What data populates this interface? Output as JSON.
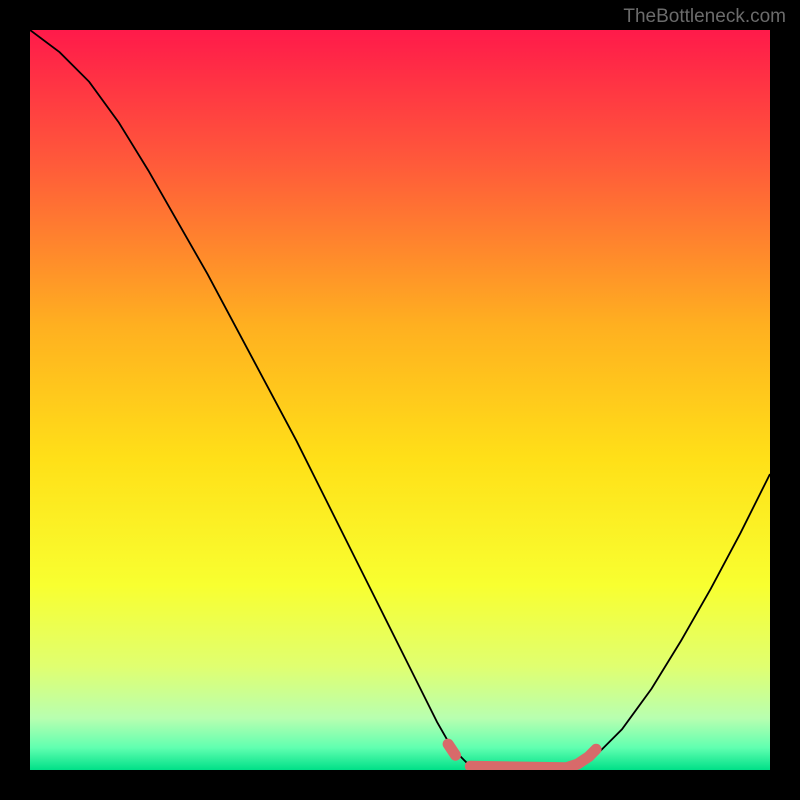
{
  "watermark": "TheBottleneck.com",
  "chart_data": {
    "type": "line",
    "title": "",
    "xlabel": "",
    "ylabel": "",
    "xlim": [
      0,
      100
    ],
    "ylim": [
      0,
      100
    ],
    "gradient_stops": [
      {
        "offset": 0,
        "color": "#ff1a4a"
      },
      {
        "offset": 18,
        "color": "#ff5a3a"
      },
      {
        "offset": 40,
        "color": "#ffb020"
      },
      {
        "offset": 58,
        "color": "#ffe018"
      },
      {
        "offset": 75,
        "color": "#f8ff30"
      },
      {
        "offset": 86,
        "color": "#e0ff70"
      },
      {
        "offset": 93,
        "color": "#b8ffb0"
      },
      {
        "offset": 97,
        "color": "#60ffb0"
      },
      {
        "offset": 100,
        "color": "#00e088"
      }
    ],
    "series": [
      {
        "name": "bottleneck-curve",
        "color": "#000000",
        "width": 1.8,
        "points": [
          {
            "x": 0,
            "y": 100
          },
          {
            "x": 4,
            "y": 97
          },
          {
            "x": 8,
            "y": 93
          },
          {
            "x": 12,
            "y": 87.5
          },
          {
            "x": 16,
            "y": 81
          },
          {
            "x": 20,
            "y": 74
          },
          {
            "x": 24,
            "y": 67
          },
          {
            "x": 28,
            "y": 59.5
          },
          {
            "x": 32,
            "y": 52
          },
          {
            "x": 36,
            "y": 44.5
          },
          {
            "x": 40,
            "y": 36.5
          },
          {
            "x": 44,
            "y": 28.5
          },
          {
            "x": 48,
            "y": 20.5
          },
          {
            "x": 52,
            "y": 12.5
          },
          {
            "x": 55,
            "y": 6.5
          },
          {
            "x": 57,
            "y": 3
          },
          {
            "x": 59,
            "y": 1
          },
          {
            "x": 61,
            "y": 0.3
          },
          {
            "x": 65,
            "y": 0
          },
          {
            "x": 70,
            "y": 0
          },
          {
            "x": 73,
            "y": 0.3
          },
          {
            "x": 75,
            "y": 1
          },
          {
            "x": 77,
            "y": 2.5
          },
          {
            "x": 80,
            "y": 5.5
          },
          {
            "x": 84,
            "y": 11
          },
          {
            "x": 88,
            "y": 17.5
          },
          {
            "x": 92,
            "y": 24.5
          },
          {
            "x": 96,
            "y": 32
          },
          {
            "x": 100,
            "y": 40
          }
        ]
      },
      {
        "name": "highlight-segment",
        "color": "#d86a6a",
        "width": 11,
        "cap": "round",
        "points": [
          {
            "x": 56.5,
            "y": 3.5
          },
          {
            "x": 57.5,
            "y": 2
          }
        ]
      },
      {
        "name": "highlight-flat",
        "color": "#d86a6a",
        "width": 11,
        "cap": "round",
        "points": [
          {
            "x": 59.5,
            "y": 0.5
          },
          {
            "x": 72.5,
            "y": 0.3
          },
          {
            "x": 74,
            "y": 0.8
          },
          {
            "x": 75.5,
            "y": 1.8
          },
          {
            "x": 76.5,
            "y": 2.8
          }
        ]
      }
    ]
  }
}
